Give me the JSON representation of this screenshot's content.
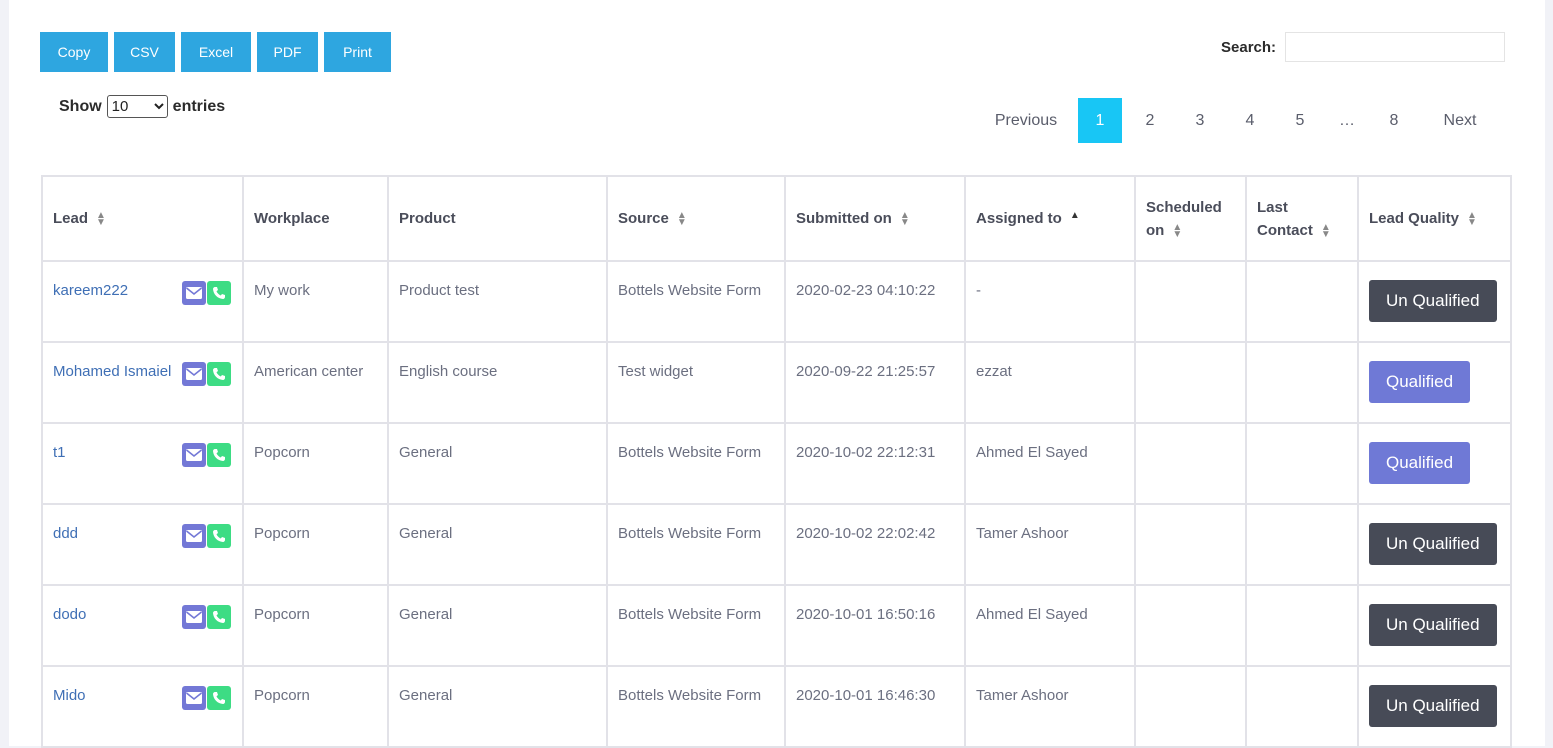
{
  "export_buttons": [
    "Copy",
    "CSV",
    "Excel",
    "PDF",
    "Print"
  ],
  "search": {
    "label": "Search:",
    "value": ""
  },
  "length": {
    "prefix": "Show",
    "selected": "10",
    "suffix": "entries"
  },
  "pagination": {
    "previous": "Previous",
    "pages": [
      "1",
      "2",
      "3",
      "4",
      "5"
    ],
    "ellipsis": "…",
    "last_page": "8",
    "next": "Next",
    "active": "1"
  },
  "table": {
    "headers": {
      "lead": "Lead",
      "workplace": "Workplace",
      "product": "Product",
      "source": "Source",
      "submitted_on": "Submitted on",
      "assigned_to": "Assigned to",
      "scheduled_on_1": "Scheduled",
      "scheduled_on_2": "on",
      "last_contact_1": "Last",
      "last_contact_2": "Contact",
      "lead_quality": "Lead Quality"
    },
    "rows": [
      {
        "lead": "kareem222",
        "workplace": "My work",
        "product": "Product test",
        "source": "Bottels Website Form",
        "submitted": "2020-02-23 04:10:22",
        "assigned": "-",
        "scheduled": "",
        "last_contact": "",
        "quality": "Un Qualified"
      },
      {
        "lead": "Mohamed Ismaiel",
        "workplace": "American center",
        "product": "English course",
        "source": "Test widget",
        "submitted": "2020-09-22 21:25:57",
        "assigned": "ezzat",
        "scheduled": "",
        "last_contact": "",
        "quality": "Qualified"
      },
      {
        "lead": "t1",
        "workplace": "Popcorn",
        "product": "General",
        "source": "Bottels Website Form",
        "submitted": "2020-10-02 22:12:31",
        "assigned": "Ahmed El Sayed",
        "scheduled": "",
        "last_contact": "",
        "quality": "Qualified"
      },
      {
        "lead": "ddd",
        "workplace": "Popcorn",
        "product": "General",
        "source": "Bottels Website Form",
        "submitted": "2020-10-02 22:02:42",
        "assigned": "Tamer Ashoor",
        "scheduled": "",
        "last_contact": "",
        "quality": "Un Qualified"
      },
      {
        "lead": "dodo",
        "workplace": "Popcorn",
        "product": "General",
        "source": "Bottels Website Form",
        "submitted": "2020-10-01 16:50:16",
        "assigned": "Ahmed El Sayed",
        "scheduled": "",
        "last_contact": "",
        "quality": "Un Qualified"
      },
      {
        "lead": "Mido",
        "workplace": "Popcorn",
        "product": "General",
        "source": "Bottels Website Form",
        "submitted": "2020-10-01 16:46:30",
        "assigned": "Tamer Ashoor",
        "scheduled": "",
        "last_contact": "",
        "quality": "Un Qualified"
      }
    ]
  },
  "colors": {
    "export_button": "#2ea6e0",
    "active_page": "#18c6f5",
    "unqualified": "#474b57",
    "qualified": "#6f79d6",
    "mail_icon": "#7378d6",
    "phone_icon": "#3ddc84",
    "lead_link": "#3f6fb5"
  },
  "icons": {
    "mail": "mail-icon",
    "phone": "phone-icon",
    "sort": "sort-icon",
    "sort_asc": "sort-asc-icon"
  }
}
